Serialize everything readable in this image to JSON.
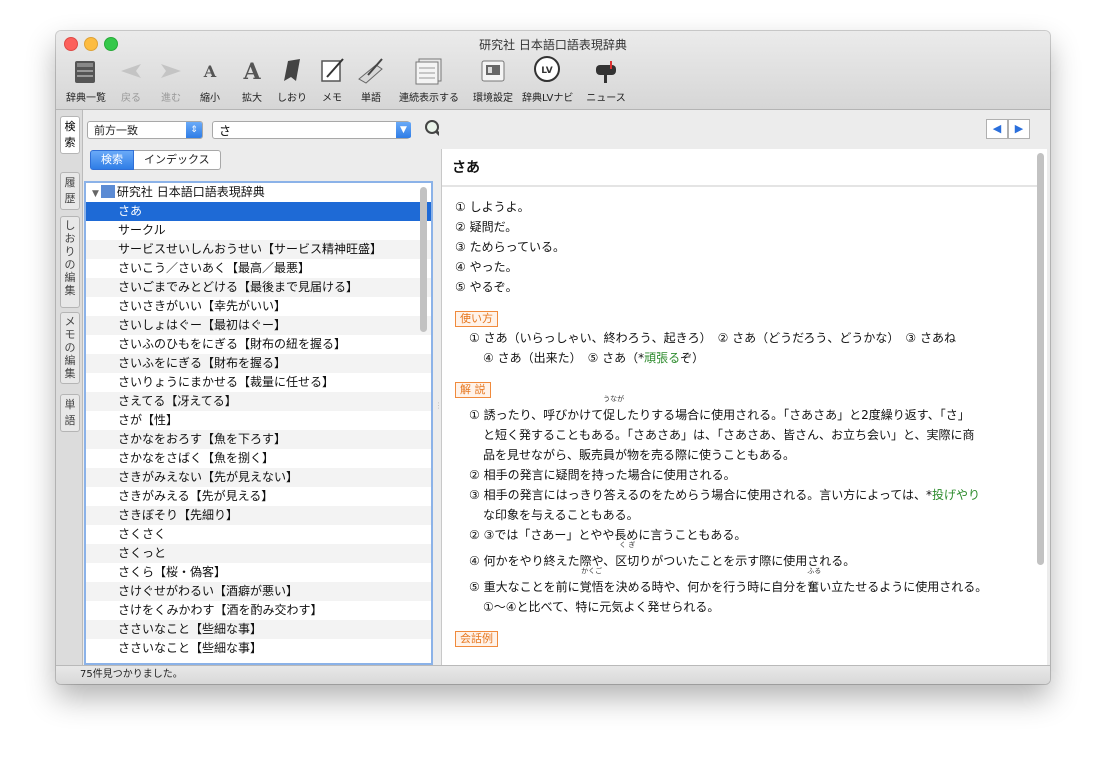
{
  "window": {
    "title": "研究社 日本語口語表現辞典"
  },
  "toolbar": {
    "items": [
      {
        "label": "辞典一覧",
        "icon": "books-icon"
      },
      {
        "label": "戻る",
        "icon": "back-arrow-icon"
      },
      {
        "label": "進む",
        "icon": "forward-arrow-icon"
      },
      {
        "label": "縮小",
        "icon": "font-smaller-icon",
        "glyph": "A"
      },
      {
        "label": "拡大",
        "icon": "font-larger-icon",
        "glyph": "A"
      },
      {
        "label": "しおり",
        "icon": "bookmark-icon"
      },
      {
        "label": "メモ",
        "icon": "memo-icon"
      },
      {
        "label": "単語",
        "icon": "word-icon"
      },
      {
        "label": "連続表示する",
        "icon": "continuous-display-icon"
      },
      {
        "label": "環境設定",
        "icon": "preferences-icon"
      },
      {
        "label": "辞典LVナビ",
        "icon": "lv-navi-icon",
        "glyph": "LV"
      },
      {
        "label": "ニュース",
        "icon": "news-mailbox-icon"
      }
    ]
  },
  "sidebar": {
    "tabs": [
      "検",
      "索",
      "履",
      "歴",
      "しおりの編集",
      "メモの編集",
      "単",
      "語"
    ]
  },
  "search": {
    "mode": "前方一致",
    "query": "さ",
    "tabs": [
      "検索",
      "インデックス"
    ]
  },
  "results": {
    "root": "研究社 日本語口語表現辞典",
    "items": [
      "さあ",
      "サークル",
      "サービスせいしんおうせい【サービス精神旺盛】",
      "さいこう／さいあく【最高／最悪】",
      "さいごまでみとどける【最後まで見届ける】",
      "さいさきがいい【幸先がいい】",
      "さいしょはぐー【最初はぐー】",
      "さいふのひもをにぎる【財布の紐を握る】",
      "さいふをにぎる【財布を握る】",
      "さいりょうにまかせる【裁量に任せる】",
      "さえてる【冴えてる】",
      "さが【性】",
      "さかなをおろす【魚を下ろす】",
      "さかなをさばく【魚を捌く】",
      "さきがみえない【先が見えない】",
      "さきがみえる【先が見える】",
      "さきぼそり【先細り】",
      "さくさく",
      "さくっと",
      "さくら【桜・偽客】",
      "さけぐせがわるい【酒癖が悪い】",
      "さけをくみかわす【酒を酌み交わす】",
      "ささいなこと【些細な事】",
      "ささいなこと【些細な事】"
    ]
  },
  "entry": {
    "headword": "さあ",
    "senses": [
      "① しようよ。",
      "② 疑問だ。",
      "③ ためらっている。",
      "④ やった。",
      "⑤ やるぞ。"
    ],
    "usage_tag": "使い方",
    "usage_line1": "① さあ（いらっしゃい、終わろう、起きろ）　② さあ（どうだろう、どうかな）　③ さあね",
    "usage_line2a": "④ さあ（出来た）　⑤ さあ（*",
    "usage_link": "頑張る",
    "usage_line2b": "ぞ）",
    "explain_tag": "解 説",
    "e1_a": "① 誘ったり、呼びかけて",
    "e1_ruby_base": "促",
    "e1_ruby": "うなが",
    "e1_b": "したりする場合に使用される。「さあさあ」と2度繰り返す、「さ」",
    "e1_c": "と短く発することもある。「さあさあ」は、「さあさあ、皆さん、お立ち会い」と、実際に商",
    "e1_d": "品を見せながら、販売員が物を売る際に使うこともある。",
    "e2": "② 相手の発言に疑問を持った場合に使用される。",
    "e3_a": "③ 相手の発言にはっきり答えるのをためらう場合に使用される。言い方によっては、*",
    "e3_link": "投げやり",
    "e3_b": "な印象を与えることもある。",
    "e23": "② ③では「さあー」とやや長めに言うこともある。",
    "e4_a": "④ 何かをやり終えた際や、",
    "e4_ruby_base": "区切",
    "e4_ruby": "く ぎ",
    "e4_b": "りがついたことを示す際に使用される。",
    "e5_a": "⑤ 重大なことを前に",
    "e5_ruby1_base": "覚悟",
    "e5_ruby1": "かくご",
    "e5_b": "を決める時や、何かを行う時に自分を",
    "e5_ruby2_base": "奮",
    "e5_ruby2": "ふる",
    "e5_c": "い立たせるように使用される。",
    "e5_d": "①～④と比べて、特に元気よく発せられる。",
    "dialogue_tag": "会話例"
  },
  "status": {
    "text": "75件見つかりました。"
  },
  "colors": {
    "accent": "#1e6ad6",
    "tag": "#e6761e",
    "link": "#2b8a2b"
  }
}
